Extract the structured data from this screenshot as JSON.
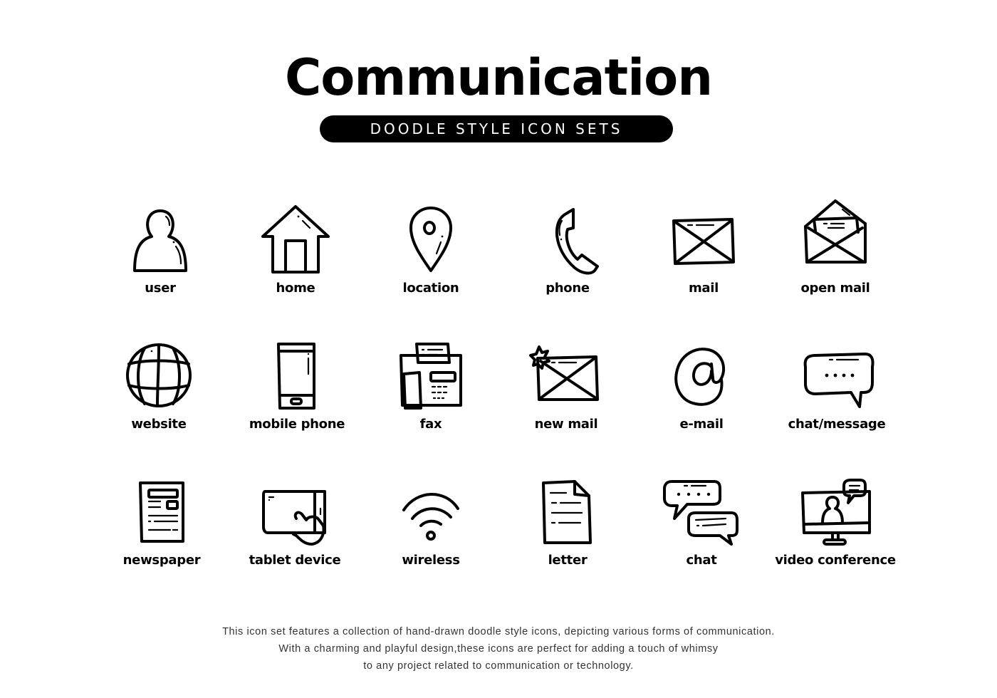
{
  "header": {
    "title": "Communication",
    "subtitle": "DOODLE STYLE ICON SETS"
  },
  "icons": [
    {
      "label": "user",
      "icon": "user-icon"
    },
    {
      "label": "home",
      "icon": "home-icon"
    },
    {
      "label": "location",
      "icon": "location-pin-icon"
    },
    {
      "label": "phone",
      "icon": "phone-handset-icon"
    },
    {
      "label": "mail",
      "icon": "mail-envelope-icon"
    },
    {
      "label": "open mail",
      "icon": "open-mail-icon"
    },
    {
      "label": "website",
      "icon": "globe-icon"
    },
    {
      "label": "mobile phone",
      "icon": "mobile-phone-icon"
    },
    {
      "label": "fax",
      "icon": "fax-machine-icon"
    },
    {
      "label": "new mail",
      "icon": "new-mail-icon"
    },
    {
      "label": "e-mail",
      "icon": "at-sign-icon"
    },
    {
      "label": "chat/message",
      "icon": "speech-bubble-icon"
    },
    {
      "label": "newspaper",
      "icon": "newspaper-icon"
    },
    {
      "label": "tablet device",
      "icon": "tablet-touch-icon"
    },
    {
      "label": "wireless",
      "icon": "wifi-icon"
    },
    {
      "label": "letter",
      "icon": "document-letter-icon"
    },
    {
      "label": "chat",
      "icon": "chat-bubbles-icon"
    },
    {
      "label": "video conference",
      "icon": "video-conference-icon"
    }
  ],
  "description": {
    "lines": [
      "This icon set features a collection of hand-drawn doodle style icons, depicting various forms of communication.",
      "With a charming and playful design,these icons are perfect for adding a touch of whimsy",
      "to any project related to communication or technology."
    ]
  },
  "colors": {
    "ink": "#000000",
    "background": "#ffffff",
    "description_text": "#333333"
  }
}
